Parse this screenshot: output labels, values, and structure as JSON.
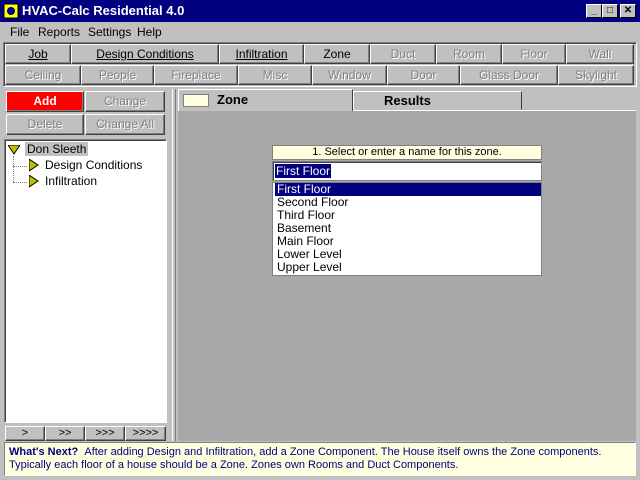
{
  "window": {
    "title": "HVAC-Calc Residential 4.0",
    "min": "_",
    "max": "□",
    "close": "✕"
  },
  "menu": [
    "File",
    "Reports",
    "Settings",
    "Help"
  ],
  "toolbar_row1": [
    "Job",
    "Design Conditions",
    "Infiltration",
    "Zone",
    "Duct",
    "Room",
    "Floor",
    "Wall"
  ],
  "toolbar_row2": [
    "Ceiling",
    "People",
    "Fireplace",
    "Misc",
    "Window",
    "Door",
    "Glass Door",
    "Skylight"
  ],
  "actions": {
    "add": "Add",
    "change": "Change",
    "delete": "Delete",
    "change_all": "Change All"
  },
  "tree": {
    "root": "Don Sleeth",
    "children": [
      "Design Conditions",
      "Infiltration"
    ]
  },
  "nav_buttons": [
    ">",
    ">>",
    ">>>",
    ">>>>"
  ],
  "tabs": {
    "zone": "Zone",
    "results": "Results"
  },
  "zone_panel": {
    "prompt": "1. Select or enter a name for this zone.",
    "input_value": "First Floor",
    "options": [
      "First Floor",
      "Second Floor",
      "Third Floor",
      "Basement",
      "Main Floor",
      "Lower Level",
      "Upper Level"
    ],
    "selected_index": 0
  },
  "whats_next": {
    "label": "What's Next?",
    "line1": "After adding Design and Infiltration, add a Zone Component. The House itself owns the Zone components.",
    "line2": "Typically each floor of a house should be a Zone.  Zones own Rooms and Duct Components."
  },
  "colors": {
    "title_bar": "#000080",
    "add_button": "#ff0000",
    "hint_bg": "#ffffe0",
    "tree_arrow": "#c0c000"
  }
}
